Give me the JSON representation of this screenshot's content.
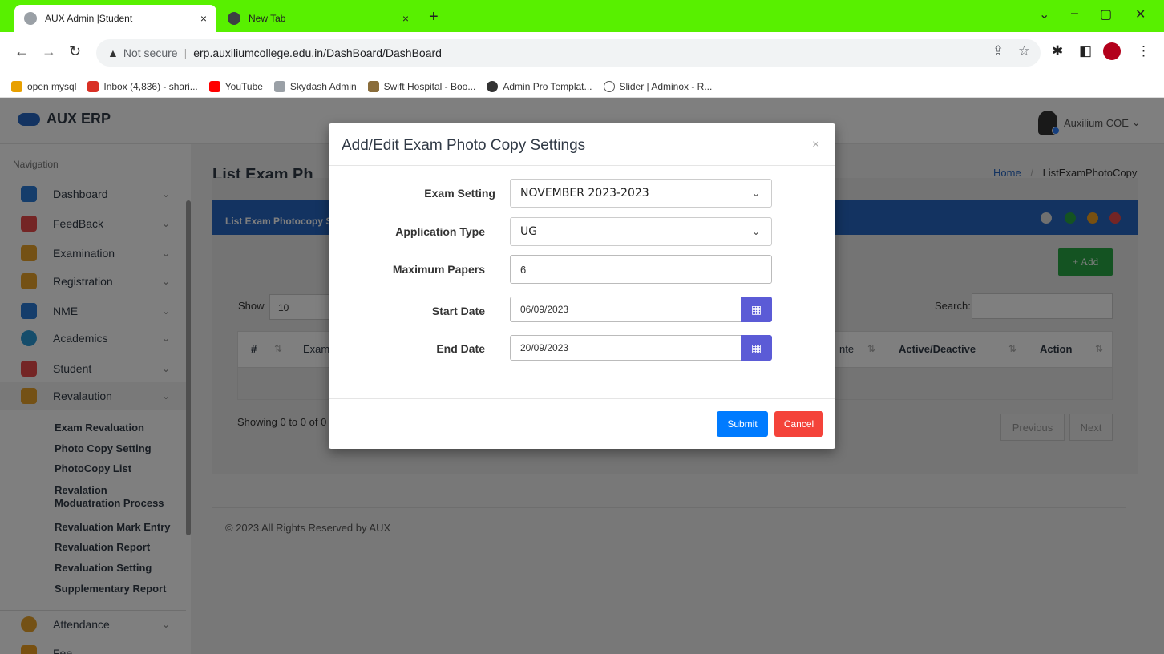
{
  "browser": {
    "tabs": [
      {
        "title": "AUX Admin |Student",
        "close": "×"
      },
      {
        "title": "New Tab",
        "close": "×"
      }
    ],
    "new_tab": "+",
    "window_controls": [
      "⌄",
      "–",
      "▢",
      "✕"
    ],
    "address": {
      "warning": "▲",
      "not_secure": "Not secure",
      "separator": "|",
      "url": "erp.auxiliumcollege.edu.in/DashBoard/DashBoard"
    },
    "bookmarks": [
      {
        "label": "open mysql",
        "color": "#e8a000"
      },
      {
        "label": "Inbox (4,836) - shari...",
        "color": "#d93025"
      },
      {
        "label": "YouTube",
        "color": "#ff0000"
      },
      {
        "label": "Skydash Admin",
        "color": "#9aa0a6"
      },
      {
        "label": "Swift Hospital - Boo...",
        "color": "#8a6d3b"
      },
      {
        "label": "Admin Pro Templat...",
        "color": "#333333"
      },
      {
        "label": "Slider | Adminox - R...",
        "color": "#555555"
      }
    ]
  },
  "app": {
    "logo": "AUX ERP",
    "user": "Auxilium COE",
    "user_chevron": "⌄",
    "nav_label": "Navigation",
    "nav": [
      {
        "label": "Dashboard",
        "color": "#2b7bd6"
      },
      {
        "label": "FeedBack",
        "color": "#e84b4b"
      },
      {
        "label": "Examination",
        "color": "#e8a22b"
      },
      {
        "label": "Registration",
        "color": "#e8a22b"
      },
      {
        "label": "NME",
        "color": "#2b7bd6"
      },
      {
        "label": "Academics",
        "color": "#2b9bd6"
      },
      {
        "label": "Student",
        "color": "#e84b4b"
      },
      {
        "label": "Revalaution",
        "color": "#e8a22b"
      },
      {
        "label": "Attendance",
        "color": "#e8a22b"
      },
      {
        "label": "Fee",
        "color": "#f0a020"
      }
    ],
    "chevron": "⌄",
    "submenu": [
      "Exam Revaluation",
      "Photo Copy Setting",
      "PhotoCopy List",
      "Revalation Moduatration Process",
      "Revaluation Mark Entry",
      "Revaluation Report",
      "Revaluation Setting",
      "Supplementary Report"
    ],
    "page_title": "List Exam Ph",
    "breadcrumb": {
      "home": "Home",
      "sep": "/",
      "current": "ListExamPhotoCopy"
    },
    "card_title": "List Exam Photocopy S",
    "add_label": "+ Add",
    "show_label": "Show",
    "show_value": "10",
    "search_label": "Search:",
    "table_headers": [
      "#",
      "Exam",
      "nte",
      "Active/Deactive",
      "Action"
    ],
    "showing": "Showing 0 to 0 of 0",
    "prev": "Previous",
    "next": "Next",
    "footer": "© 2023 All Rights Reserved by AUX"
  },
  "modal": {
    "title": "Add/Edit Exam Photo Copy Settings",
    "close": "×",
    "fields": {
      "exam_setting": {
        "label": "Exam Setting",
        "value": "NOVEMBER 2023-2023"
      },
      "application_type": {
        "label": "Application Type",
        "value": "UG"
      },
      "maximum_papers": {
        "label": "Maximum Papers",
        "value": "6"
      },
      "start_date": {
        "label": "Start Date",
        "value": "06/09/2023"
      },
      "end_date": {
        "label": "End Date",
        "value": "20/09/2023"
      }
    },
    "submit": "Submit",
    "cancel": "Cancel"
  },
  "colors": {
    "accent": "#2767c2",
    "success": "#28a745",
    "primary": "#007bff",
    "danger": "#f4433a",
    "calendar": "#5b5bd6",
    "chrome": "#58f000"
  }
}
